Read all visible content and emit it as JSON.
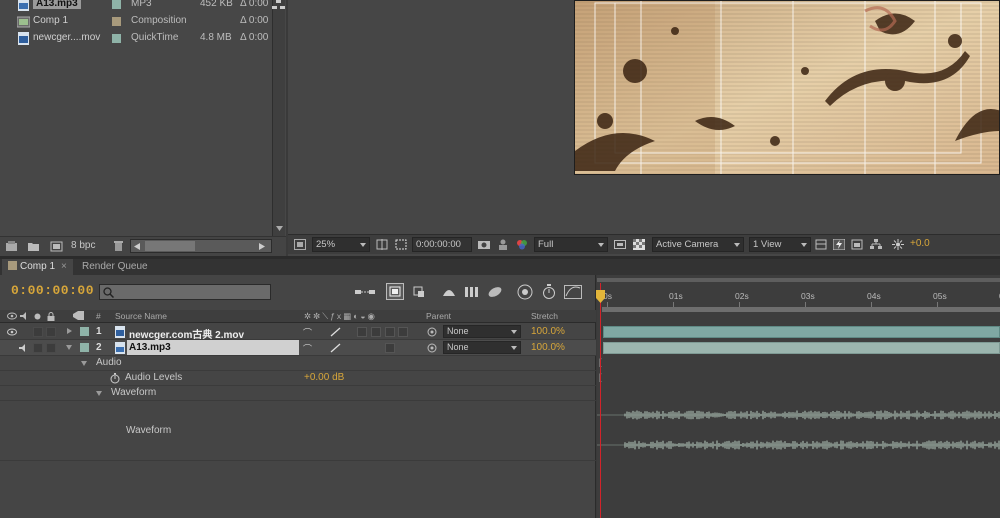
{
  "project": {
    "items": [
      {
        "name": "A13.mp3",
        "type": "MP3",
        "size": "452 KB",
        "duration": "Δ 0:00",
        "label_color": "#8fb3a8",
        "icon": "audio-file-icon",
        "selected": true
      },
      {
        "name": "Comp 1",
        "type": "Composition",
        "size": "",
        "duration": "Δ 0:00",
        "label_color": "#a89a7c",
        "icon": "composition-icon",
        "selected": false
      },
      {
        "name": "newcger....mov",
        "type": "QuickTime",
        "size": "4.8 MB",
        "duration": "Δ 0:00",
        "label_color": "#8fb3a8",
        "icon": "video-file-icon",
        "selected": false
      }
    ],
    "bpc": "8 bpc"
  },
  "viewer": {
    "zoom": "25%",
    "timecode": "0:00:00:00",
    "resolution": "Full",
    "camera": "Active Camera",
    "views": "1 View",
    "exposure": "+0.0"
  },
  "timeline": {
    "tabs": [
      "Comp 1",
      "Render Queue"
    ],
    "timecode": "0:00:00:00",
    "columns": {
      "hash": "#",
      "source_name": "Source Name",
      "parent": "Parent",
      "stretch": "Stretch"
    },
    "ruler": [
      "0s",
      "01s",
      "02s",
      "03s",
      "04s",
      "05s",
      "06"
    ],
    "layers": [
      {
        "index": "1",
        "name": "newcger.com古典 2.mov",
        "parent": "None",
        "stretch": "100.0%",
        "label_color": "#8fb3a8"
      },
      {
        "index": "2",
        "name": "A13.mp3",
        "parent": "None",
        "stretch": "100.0%",
        "label_color": "#8fb3a8"
      }
    ],
    "props": {
      "audio": "Audio",
      "audio_levels": "Audio Levels",
      "audio_levels_value": "+0.00 dB",
      "waveform_group": "Waveform",
      "waveform": "Waveform"
    }
  },
  "colors": {
    "accent": "#d7a63a",
    "playhead": "#d2232a",
    "video_bar": "#7fa8a3",
    "audio_bar": "#9bb5ae"
  }
}
